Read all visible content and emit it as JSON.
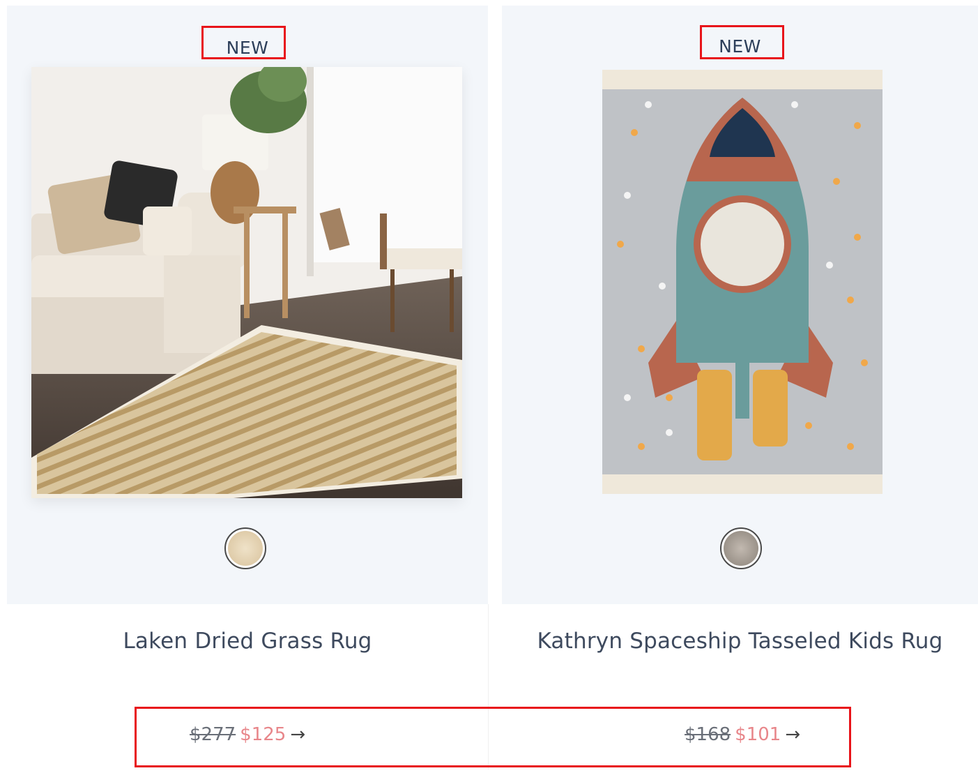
{
  "products": [
    {
      "badge": "NEW",
      "title": "Laken Dried Grass Rug",
      "old_price": "$277",
      "sale_price": "$125",
      "arrow": "→",
      "swatch_color": "#e8d8bb"
    },
    {
      "badge": "NEW",
      "title": "Kathryn Spaceship Tasseled Kids Rug",
      "old_price": "$168",
      "sale_price": "$101",
      "arrow": "→",
      "swatch_color": "#9a9a9a"
    }
  ],
  "colors": {
    "highlight": "#e8141a",
    "sale_price": "#e8868a",
    "card_bg": "#f3f6fa"
  }
}
